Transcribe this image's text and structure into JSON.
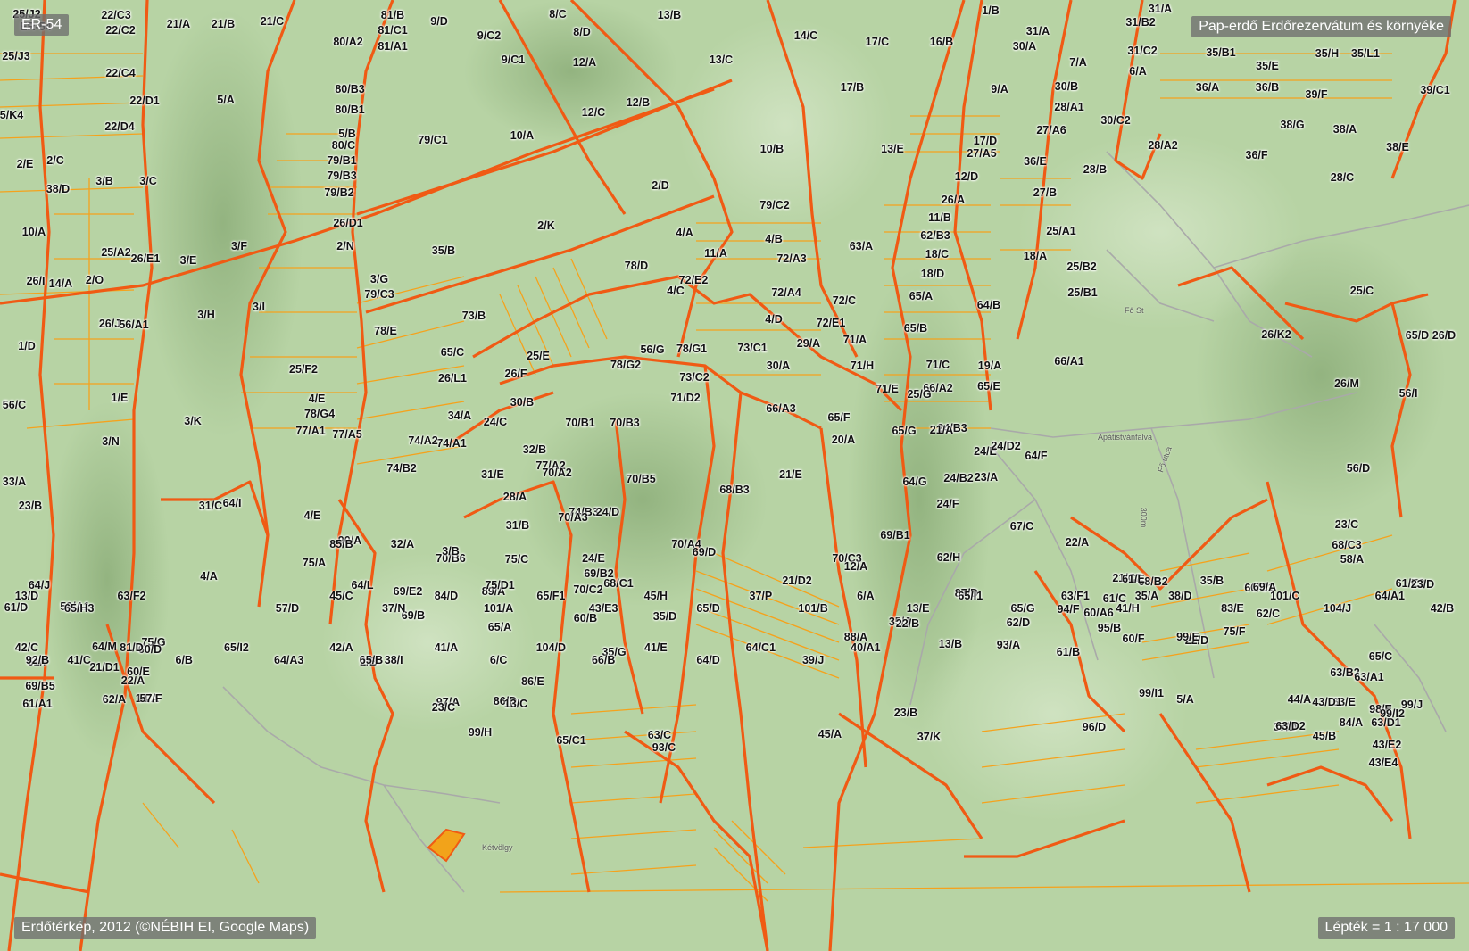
{
  "header": {
    "map_code": "ER-54",
    "title": "Pap-erdő Erdőrezervátum és környéke"
  },
  "footer": {
    "source": "Erdőtérkép, 2012 (©NÉBIH EI, Google Maps)",
    "scale": "Lépték = 1 : 17 000"
  },
  "colors": {
    "terrain": "#b7d3a4",
    "stand_boundary": "#f05a14",
    "subcompartment_line": "#f5a21c",
    "road": "#b0b0b0",
    "badge_bg": "#6e6e6e"
  },
  "place_names": [
    "Fő utca",
    "Fő St",
    "Apátistvánfalva",
    "Kétvölgy",
    "300m"
  ],
  "stand_labels": [
    "25/J2",
    "22/C3",
    "21/A",
    "21/B",
    "21/C",
    "81/B",
    "9/D",
    "8/C",
    "13/B",
    "1/B",
    "31/B2",
    "31/A",
    "ER-54",
    "22/C2",
    "80/A2",
    "81/C1",
    "9/C2",
    "8/D",
    "31/A",
    "30/A",
    "31/C2",
    "25/J3",
    "22/C4",
    "81/A1",
    "9/C1",
    "12/A",
    "13/C",
    "14/C",
    "17/C",
    "16/B",
    "35/B1",
    "35/E",
    "35/H",
    "35/L1",
    "5/K4",
    "22/D1",
    "5/A",
    "80/B3",
    "12/B",
    "17/B",
    "9/A",
    "7/A",
    "6/A",
    "36/A",
    "36/B",
    "39/F",
    "39/C1",
    "22/D4",
    "80/B1",
    "12/C",
    "30/B",
    "28/A1",
    "30/C2",
    "38/G",
    "38/A",
    "38/E",
    "2/E",
    "2/C",
    "3/B",
    "3/C",
    "5/B",
    "80/C",
    "79/B1",
    "79/B3",
    "79/B2",
    "79/C1",
    "10/A",
    "10/B",
    "13/E",
    "17/D",
    "27/A5",
    "27/A6",
    "28/A2",
    "36/F",
    "36/E",
    "28/B",
    "28/C",
    "38/D",
    "2/D",
    "12/D",
    "27/B",
    "26/A",
    "10/A",
    "26/D1",
    "2/K",
    "79/C2",
    "11/B",
    "62/B3",
    "25/A1",
    "25/A2",
    "26/E1",
    "3/F",
    "3/E",
    "4/A",
    "4/B",
    "72/A3",
    "63/A",
    "18/C",
    "18/A",
    "25/B2",
    "26/I",
    "14/A",
    "2/O",
    "2/N",
    "3/G",
    "79/C3",
    "35/B",
    "78/D",
    "11/A",
    "72/E2",
    "72/A4",
    "72/C",
    "18/D",
    "65/A",
    "25/B1",
    "25/C",
    "26/J",
    "56/A1",
    "3/H",
    "3/I",
    "4/C",
    "4/D",
    "72/E1",
    "64/B",
    "65/B",
    "26/K2",
    "26/D",
    "1/D",
    "78/E",
    "73/B",
    "65/C",
    "25/E",
    "56/G",
    "78/G1",
    "73/C1",
    "29/A",
    "71/A",
    "71/C",
    "19/A",
    "66/A1",
    "65/D",
    "25/F2",
    "26/L1",
    "26/F",
    "78/G2",
    "73/C2",
    "30/A",
    "71/H",
    "71/E",
    "66/A2",
    "65/E",
    "26/M",
    "56/C",
    "1/E",
    "3/K",
    "4/E",
    "78/G4",
    "34/A",
    "74/A1",
    "30/B",
    "70/B1",
    "70/B3",
    "71/D2",
    "66/A3",
    "65/F",
    "25/G",
    "24/B3",
    "56/I",
    "3/N",
    "77/A1",
    "77/A5",
    "74/A2",
    "24/C",
    "20/A",
    "65/G",
    "21/A",
    "24/E",
    "24/D2",
    "64/F",
    "64/G",
    "32/B",
    "31/E",
    "77/A2",
    "74/B2",
    "28/A",
    "70/A2",
    "70/B5",
    "68/B3",
    "21/E",
    "24/B2",
    "23/A",
    "56/D",
    "33/A",
    "31/C",
    "31/B",
    "74/B3",
    "70/A3",
    "24/D",
    "67/C",
    "22/A",
    "23/C",
    "23/B",
    "4/E",
    "64/I",
    "90/A",
    "32/A",
    "70/B6",
    "24/E",
    "70/A4",
    "69/B1",
    "24/F",
    "21/C2",
    "58/A",
    "61/E2",
    "64/J",
    "3/B",
    "4/A",
    "75/A",
    "75/C",
    "70/C3",
    "68/B2",
    "68/C3",
    "23/D",
    "61/D",
    "59/A1",
    "57/D",
    "64/L",
    "89/A",
    "69/B2",
    "68/C1",
    "21/D2",
    "12/A",
    "61/E",
    "60/C1",
    "61/I",
    "64/M",
    "2/B",
    "69/B",
    "75/D1",
    "70/C2",
    "69/D",
    "62/H",
    "61/C",
    "35/A",
    "35/B",
    "92/B",
    "75/G",
    "69/E2",
    "60/B",
    "65/A",
    "35/D",
    "88/A",
    "75/F",
    "69/A",
    "69/B5",
    "21/D1",
    "22/A",
    "62/A",
    "60/D",
    "65/B",
    "35/G",
    "35/J",
    "87/D",
    "93/A",
    "94/F",
    "95/B",
    "22/D",
    "62/C",
    "61/A1",
    "60/E",
    "14/A",
    "57/F",
    "86/D",
    "86/E",
    "93/C",
    "23/B",
    "22/B",
    "13/B",
    "62/D",
    "61/B",
    "60/A6",
    "60/F",
    "99/E",
    "63/B2",
    "63/A1",
    "65/C",
    "85/B",
    "97/A",
    "99/H",
    "23/C",
    "13/C",
    "65/C1",
    "63/C",
    "45/A",
    "37/K",
    "96/D",
    "99/I1",
    "5/A",
    "63/E",
    "63/D1",
    "44/A",
    "43/D1",
    "45/B",
    "37/D",
    "84/A",
    "98/E",
    "99/I2",
    "99/J",
    "13/D",
    "65/H3",
    "63/F2",
    "63/D2",
    "43/E2",
    "43/E4",
    "45/C",
    "37/N",
    "84/D",
    "101/A",
    "65/F1",
    "43/E3",
    "45/H",
    "65/D",
    "37/P",
    "101/B",
    "6/A",
    "13/E",
    "65/I1",
    "65/G",
    "63/F1",
    "41/H",
    "38/D",
    "83/E",
    "101/C",
    "104/J",
    "64/A1",
    "42/B",
    "42/C",
    "41/C",
    "81/D",
    "6/B",
    "65/I2",
    "64/A3",
    "42/A",
    "38/I",
    "41/A",
    "6/C",
    "104/D",
    "66/B",
    "41/E",
    "64/D",
    "64/C1",
    "39/J",
    "40/A1"
  ]
}
